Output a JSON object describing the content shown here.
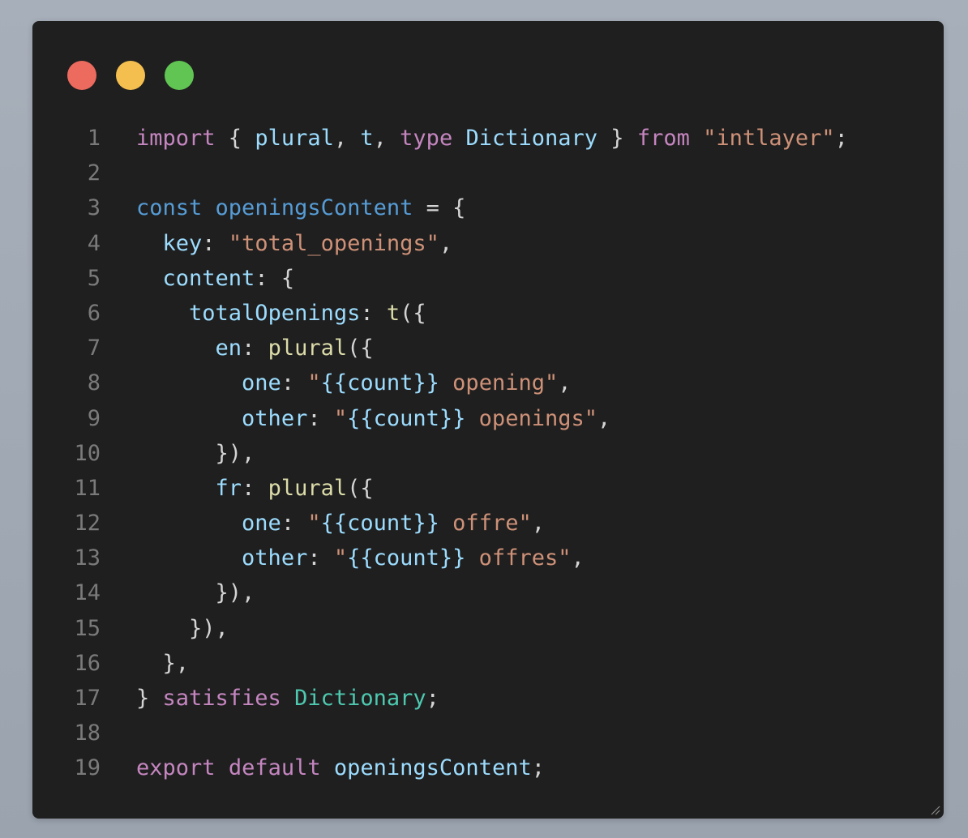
{
  "window": {
    "controls": [
      {
        "name": "close",
        "color": "#ed6a5e"
      },
      {
        "name": "minimize",
        "color": "#f5bf4f"
      },
      {
        "name": "zoom",
        "color": "#61c554"
      }
    ]
  },
  "theme": {
    "keyword": "#c586c0",
    "storage": "#569cd6",
    "variable": "#9cdcfe",
    "function": "#dcdcaa",
    "string": "#ce9178",
    "type": "#4ec9b0",
    "plain": "#d4d4d4",
    "line_number": "#7a7a7a"
  },
  "code": {
    "lines": [
      {
        "n": "1",
        "tokens": [
          {
            "t": "import",
            "k": "keyword"
          },
          {
            "t": " { ",
            "k": "plain"
          },
          {
            "t": "plural",
            "k": "variable"
          },
          {
            "t": ", ",
            "k": "plain"
          },
          {
            "t": "t",
            "k": "variable"
          },
          {
            "t": ", ",
            "k": "plain"
          },
          {
            "t": "type",
            "k": "keyword"
          },
          {
            "t": " ",
            "k": "plain"
          },
          {
            "t": "Dictionary",
            "k": "variable"
          },
          {
            "t": " } ",
            "k": "plain"
          },
          {
            "t": "from",
            "k": "keyword"
          },
          {
            "t": " ",
            "k": "plain"
          },
          {
            "t": "\"intlayer\"",
            "k": "string"
          },
          {
            "t": ";",
            "k": "plain"
          }
        ]
      },
      {
        "n": "2",
        "tokens": []
      },
      {
        "n": "3",
        "tokens": [
          {
            "t": "const",
            "k": "storage"
          },
          {
            "t": " ",
            "k": "plain"
          },
          {
            "t": "openingsContent",
            "k": "storage"
          },
          {
            "t": " = {",
            "k": "plain"
          }
        ]
      },
      {
        "n": "4",
        "tokens": [
          {
            "t": "  ",
            "k": "plain"
          },
          {
            "t": "key",
            "k": "variable"
          },
          {
            "t": ": ",
            "k": "plain"
          },
          {
            "t": "\"total_openings\"",
            "k": "string"
          },
          {
            "t": ",",
            "k": "plain"
          }
        ]
      },
      {
        "n": "5",
        "tokens": [
          {
            "t": "  ",
            "k": "plain"
          },
          {
            "t": "content",
            "k": "variable"
          },
          {
            "t": ": {",
            "k": "plain"
          }
        ]
      },
      {
        "n": "6",
        "tokens": [
          {
            "t": "    ",
            "k": "plain"
          },
          {
            "t": "totalOpenings",
            "k": "variable"
          },
          {
            "t": ": ",
            "k": "plain"
          },
          {
            "t": "t",
            "k": "function"
          },
          {
            "t": "({",
            "k": "plain"
          }
        ]
      },
      {
        "n": "7",
        "tokens": [
          {
            "t": "      ",
            "k": "plain"
          },
          {
            "t": "en",
            "k": "variable"
          },
          {
            "t": ": ",
            "k": "plain"
          },
          {
            "t": "plural",
            "k": "function"
          },
          {
            "t": "({",
            "k": "plain"
          }
        ]
      },
      {
        "n": "8",
        "tokens": [
          {
            "t": "        ",
            "k": "plain"
          },
          {
            "t": "one",
            "k": "variable"
          },
          {
            "t": ": ",
            "k": "plain"
          },
          {
            "t": "\"",
            "k": "string"
          },
          {
            "t": "{{count}}",
            "k": "variable"
          },
          {
            "t": " opening\"",
            "k": "string"
          },
          {
            "t": ",",
            "k": "plain"
          }
        ]
      },
      {
        "n": "9",
        "tokens": [
          {
            "t": "        ",
            "k": "plain"
          },
          {
            "t": "other",
            "k": "variable"
          },
          {
            "t": ": ",
            "k": "plain"
          },
          {
            "t": "\"",
            "k": "string"
          },
          {
            "t": "{{count}}",
            "k": "variable"
          },
          {
            "t": " openings\"",
            "k": "string"
          },
          {
            "t": ",",
            "k": "plain"
          }
        ]
      },
      {
        "n": "10",
        "tokens": [
          {
            "t": "      }),",
            "k": "plain"
          }
        ]
      },
      {
        "n": "11",
        "tokens": [
          {
            "t": "      ",
            "k": "plain"
          },
          {
            "t": "fr",
            "k": "variable"
          },
          {
            "t": ": ",
            "k": "plain"
          },
          {
            "t": "plural",
            "k": "function"
          },
          {
            "t": "({",
            "k": "plain"
          }
        ]
      },
      {
        "n": "12",
        "tokens": [
          {
            "t": "        ",
            "k": "plain"
          },
          {
            "t": "one",
            "k": "variable"
          },
          {
            "t": ": ",
            "k": "plain"
          },
          {
            "t": "\"",
            "k": "string"
          },
          {
            "t": "{{count}}",
            "k": "variable"
          },
          {
            "t": " offre\"",
            "k": "string"
          },
          {
            "t": ",",
            "k": "plain"
          }
        ]
      },
      {
        "n": "13",
        "tokens": [
          {
            "t": "        ",
            "k": "plain"
          },
          {
            "t": "other",
            "k": "variable"
          },
          {
            "t": ": ",
            "k": "plain"
          },
          {
            "t": "\"",
            "k": "string"
          },
          {
            "t": "{{count}}",
            "k": "variable"
          },
          {
            "t": " offres\"",
            "k": "string"
          },
          {
            "t": ",",
            "k": "plain"
          }
        ]
      },
      {
        "n": "14",
        "tokens": [
          {
            "t": "      }),",
            "k": "plain"
          }
        ]
      },
      {
        "n": "15",
        "tokens": [
          {
            "t": "    }),",
            "k": "plain"
          }
        ]
      },
      {
        "n": "16",
        "tokens": [
          {
            "t": "  },",
            "k": "plain"
          }
        ]
      },
      {
        "n": "17",
        "tokens": [
          {
            "t": "} ",
            "k": "plain"
          },
          {
            "t": "satisfies",
            "k": "keyword"
          },
          {
            "t": " ",
            "k": "plain"
          },
          {
            "t": "Dictionary",
            "k": "type"
          },
          {
            "t": ";",
            "k": "plain"
          }
        ]
      },
      {
        "n": "18",
        "tokens": []
      },
      {
        "n": "19",
        "tokens": [
          {
            "t": "export",
            "k": "keyword"
          },
          {
            "t": " ",
            "k": "plain"
          },
          {
            "t": "default",
            "k": "keyword"
          },
          {
            "t": " ",
            "k": "plain"
          },
          {
            "t": "openingsContent",
            "k": "variable"
          },
          {
            "t": ";",
            "k": "plain"
          }
        ]
      }
    ]
  }
}
